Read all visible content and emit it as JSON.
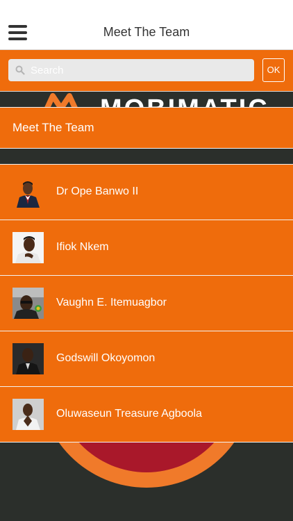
{
  "header": {
    "title": "Meet The Team",
    "menu_icon": "hamburger-menu-icon"
  },
  "search": {
    "placeholder": "Search",
    "value": "",
    "ok_label": "OK",
    "icon": "search-icon"
  },
  "background": {
    "logo_text": "MOBIMATIC"
  },
  "section": {
    "title": "Meet The Team"
  },
  "team": [
    {
      "name": "Dr Ope Banwo II",
      "avatar": "avatar-photo"
    },
    {
      "name": "Ifiok Nkem",
      "avatar": "avatar-photo"
    },
    {
      "name": "Vaughn E. Itemuagbor",
      "avatar": "avatar-photo"
    },
    {
      "name": "Godswill Okoyomon",
      "avatar": "avatar-photo"
    },
    {
      "name": "Oluwaseun Treasure Agboola",
      "avatar": "avatar-photo"
    }
  ],
  "colors": {
    "accent": "#ef6c0c",
    "background": "#2b2f2b",
    "header_bg": "#ffffff",
    "circle_outer": "#f07a2a",
    "circle_inner": "#a9182a"
  }
}
